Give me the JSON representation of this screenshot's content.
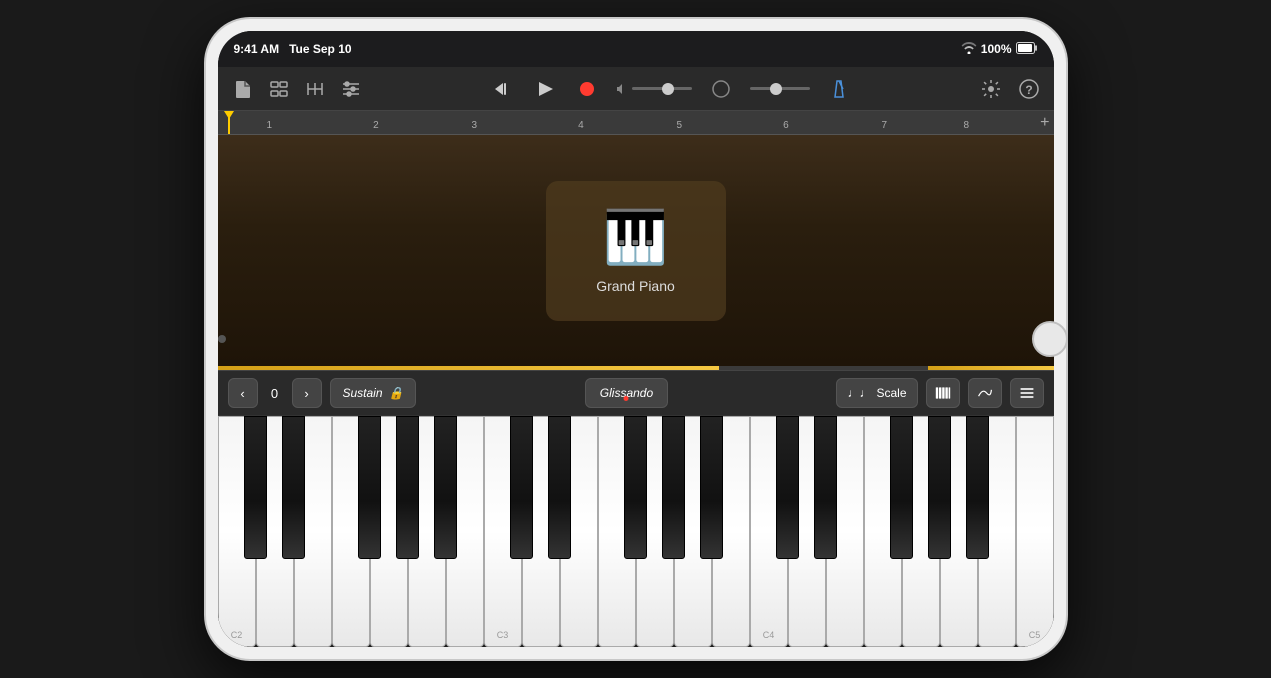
{
  "status_bar": {
    "time": "9:41 AM",
    "date": "Tue Sep 10",
    "wifi": "WiFi",
    "battery": "100%"
  },
  "toolbar": {
    "new_btn": "New",
    "tracks_btn": "Tracks",
    "mixer_btn": "Mixer",
    "controls_btn": "Controls",
    "rewind_btn": "Rewind",
    "play_btn": "Play",
    "record_btn": "Record",
    "metronome_btn": "Metronome",
    "settings_btn": "Settings",
    "help_btn": "Help"
  },
  "timeline": {
    "markers": [
      "1",
      "2",
      "3",
      "4",
      "5",
      "6",
      "7",
      "8"
    ],
    "add_btn": "+"
  },
  "instrument": {
    "name": "Grand Piano",
    "icon": "🎹"
  },
  "keyboard_controls": {
    "prev_octave": "<",
    "octave_num": "0",
    "next_octave": ">",
    "sustain": "Sustain",
    "glissando": "Glissando",
    "scale_label": "Scale",
    "note_icon": "♩",
    "keyboard_icon": "⊞",
    "arp_icon": "~",
    "chord_icon": "≡"
  },
  "piano": {
    "keys": [
      "C2",
      "",
      "",
      "",
      "",
      "",
      "",
      "",
      "",
      "",
      "",
      "",
      "",
      "",
      "C3",
      "",
      "",
      "",
      "",
      "",
      "",
      "",
      "",
      "",
      "",
      "",
      "",
      "",
      "C4"
    ],
    "c_labels": [
      "C2",
      "C3",
      "C4"
    ]
  }
}
